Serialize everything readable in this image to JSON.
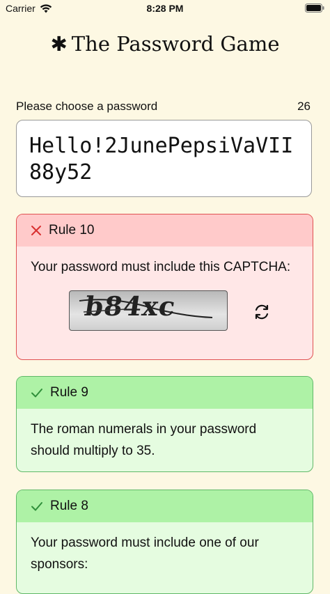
{
  "status_bar": {
    "carrier": "Carrier",
    "time": "8:28 PM"
  },
  "header": {
    "title": "The Password Game"
  },
  "prompt": {
    "label": "Please choose a password",
    "char_count": "26"
  },
  "password": {
    "value": "Hello!2JunePepsiVaVII88y52"
  },
  "rules": [
    {
      "title": "Rule 10",
      "status": "fail",
      "text": "Your password must include this CAPTCHA:",
      "captcha": "b84xc"
    },
    {
      "title": "Rule 9",
      "status": "pass",
      "text": "The roman numerals in your password should multiply to 35."
    },
    {
      "title": "Rule 8",
      "status": "pass",
      "text": "Your password must include one of our sponsors:"
    }
  ],
  "colors": {
    "fail_border": "#e05050",
    "pass_border": "#60b868",
    "background": "#fdf8e3"
  }
}
